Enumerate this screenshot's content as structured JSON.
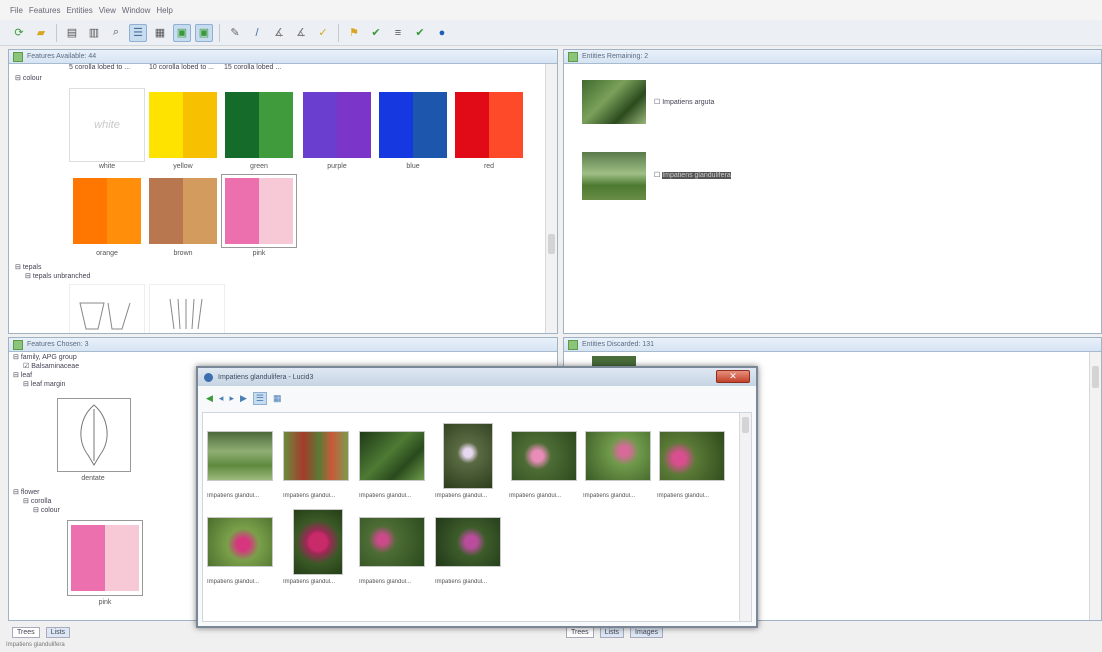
{
  "menu": [
    "File",
    "Features",
    "Entities",
    "View",
    "Window",
    "Help"
  ],
  "toolbar": {
    "icons": [
      "refresh-icon",
      "folder-open-icon",
      "save-icon",
      "save-all-icon",
      "find-icon",
      "list-view-icon",
      "tree-view-icon",
      "image-view-icon",
      "image-view2-icon",
      "tag-icon",
      "pencil-icon",
      "ruler-icon",
      "ruler2-icon",
      "pin-icon",
      "filter-icon",
      "check-icon",
      "lines-icon",
      "check2-icon",
      "help-icon"
    ]
  },
  "features_available": {
    "title": "Features Available: 44",
    "top_labels": [
      "5 corolla lobed to ...",
      "10 corolla lobed to ...",
      "15 corolla lobed ..."
    ],
    "colour_node": "colour",
    "swatches": [
      {
        "label": "white",
        "c1": "#ffffff",
        "c2": "#ffffff",
        "text": "white"
      },
      {
        "label": "yellow",
        "c1": "#ffe300",
        "c2": "#f7c000"
      },
      {
        "label": "green",
        "c1": "#156b2a",
        "c2": "#3f9b3b"
      },
      {
        "label": "purple",
        "c1": "#6a3fd0",
        "c2": "#7b35c8"
      },
      {
        "label": "blue",
        "c1": "#1538e0",
        "c2": "#1c57ad"
      },
      {
        "label": "red",
        "c1": "#e10b18",
        "c2": "#ff4a2a"
      },
      {
        "label": "orange",
        "c1": "#ff7600",
        "c2": "#ff8e0a"
      },
      {
        "label": "brown",
        "c1": "#b8774f",
        "c2": "#d39b5e"
      },
      {
        "label": "pink",
        "c1": "#ec6fae",
        "c2": "#f7c9d7"
      }
    ],
    "tepals_node": "tepals",
    "tepals_child": "tepals unbranched"
  },
  "entities_remaining": {
    "title": "Entities Remaining: 2",
    "items": [
      "Impatiens arguta",
      "Impatiens glandulifera"
    ]
  },
  "features_chosen": {
    "title": "Features Chosen: 3",
    "tree": [
      "family, APG group",
      "Balsaminaceae",
      "leaf",
      "leaf margin",
      "dentate",
      "flower",
      "corolla",
      "colour",
      "pink"
    ]
  },
  "entities_discarded": {
    "title": "Entities Discarded: 131"
  },
  "dialog": {
    "title": "Impatiens glandulifera - Lucid3",
    "close": "✕",
    "photos": [
      "Impatiens glandul...",
      "Impatiens glandul...",
      "Impatiens glandul...",
      "Impatiens glandul...",
      "Impatiens glandul...",
      "Impatiens glandul...",
      "Impatiens glandul...",
      "Impatiens glandul...",
      "Impatiens glandul...",
      "Impatiens glandul...",
      "Impatiens glandul..."
    ]
  },
  "bottom_left_tabs": [
    "Trees",
    "Lists"
  ],
  "bottom_right_tabs": [
    "Trees",
    "Lists",
    "Images"
  ],
  "status": "Impatiens glandulifera"
}
